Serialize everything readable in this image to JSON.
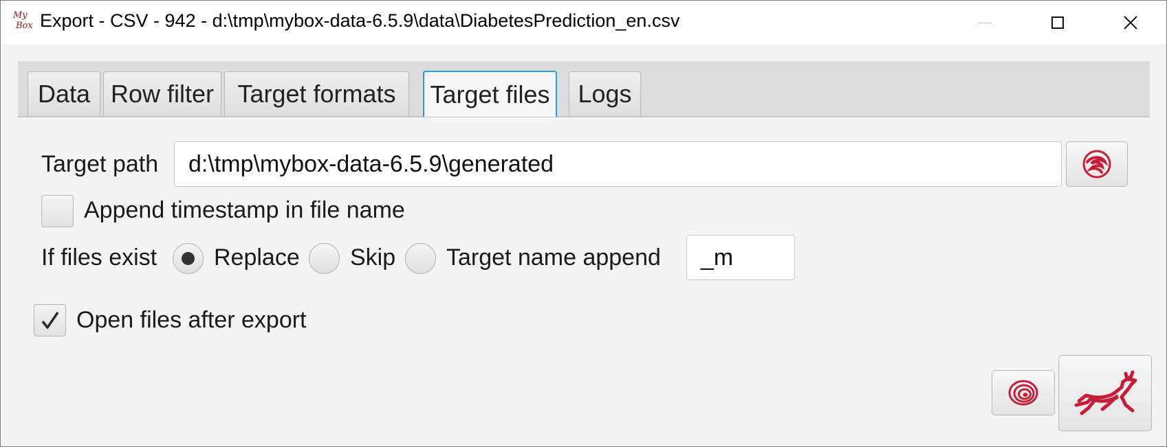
{
  "window": {
    "title": "Export - CSV - 942 - d:\\tmp\\mybox-data-6.5.9\\data\\DiabetesPrediction_en.csv",
    "app_icon_text_top": "My",
    "app_icon_text_bottom": "Box"
  },
  "tabs": [
    {
      "label": "Data",
      "selected": false
    },
    {
      "label": "Row filter",
      "selected": false
    },
    {
      "label": "Target formats",
      "selected": false
    },
    {
      "label": "Target files",
      "selected": true
    },
    {
      "label": "Logs",
      "selected": false
    }
  ],
  "target_path": {
    "label": "Target path",
    "value": "d:\\tmp\\mybox-data-6.5.9\\generated",
    "browse_icon": "mybox-swirl-icon"
  },
  "append_timestamp": {
    "label": "Append timestamp in file name",
    "checked": false
  },
  "if_files_exist": {
    "label": "If files exist",
    "options": [
      {
        "label": "Replace",
        "selected": true
      },
      {
        "label": "Skip",
        "selected": false
      },
      {
        "label": "Target name append",
        "selected": false
      }
    ],
    "append_value": "_m"
  },
  "open_after_export": {
    "label": "Open files after export",
    "checked": true
  },
  "actions": {
    "recover_icon": "spiral-icon",
    "start_icon": "running-deer-icon"
  },
  "colors": {
    "accent": "#c41e3a",
    "tab_focus": "#2f9ed6"
  }
}
